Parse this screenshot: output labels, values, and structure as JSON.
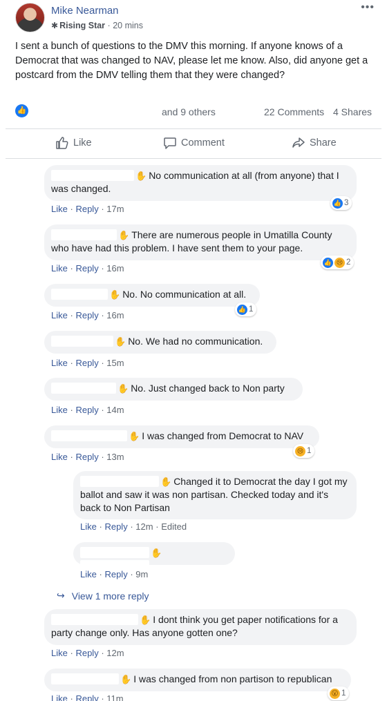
{
  "post": {
    "author": "Mike Nearman",
    "badge": "Rising Star",
    "time": "20 mins",
    "text": "I sent a bunch of questions to the DMV this morning. If anyone knows of a Democrat that was changed to NAV, please let me know. Also, did anyone get a postcard from the DMV telling them that they were changed?",
    "separator": "·",
    "more_icon": "•••"
  },
  "stats": {
    "others": "and 9 others",
    "comments": "22 Comments",
    "shares": "4 Shares"
  },
  "actions": {
    "like": "Like",
    "comment": "Comment",
    "share": "Share"
  },
  "comment_actions": {
    "like": "Like",
    "reply": "Reply",
    "sep": "·"
  },
  "comments": [
    {
      "text": "No communication at all (from anyone) that I was changed.",
      "time": "17m",
      "reactions": "3"
    },
    {
      "text": "There are numerous people in Umatilla County who have had this problem. I have sent them to your page.",
      "time": "16m",
      "reactions": "2"
    },
    {
      "text": "No. No communication at all.",
      "time": "16m",
      "reactions": "1"
    },
    {
      "text": "No. We had no communication.",
      "time": "15m"
    },
    {
      "text": "No. Just changed back to Non party",
      "time": "14m"
    },
    {
      "text": "I was changed from Democrat to NAV",
      "time": "13m",
      "reactions": "1"
    },
    {
      "text": "Changed it to Democrat the day I got my ballot and saw it was non partisan. Checked today and it's back to Non Partisan",
      "time": "12m",
      "edited": "Edited"
    },
    {
      "text": "",
      "time": "9m"
    },
    {
      "text": "I dont think you get paper notifications for a party change only. Has anyone gotten one?",
      "time": "12m"
    },
    {
      "text": "I was changed from non partison to republican",
      "time": "11m",
      "reactions": "1"
    }
  ],
  "view_more": "View 1 more reply",
  "colors": {
    "link": "#385898",
    "bubble": "#f2f3f5",
    "like_blue": "#1877f2",
    "divider": "#dadde1"
  }
}
